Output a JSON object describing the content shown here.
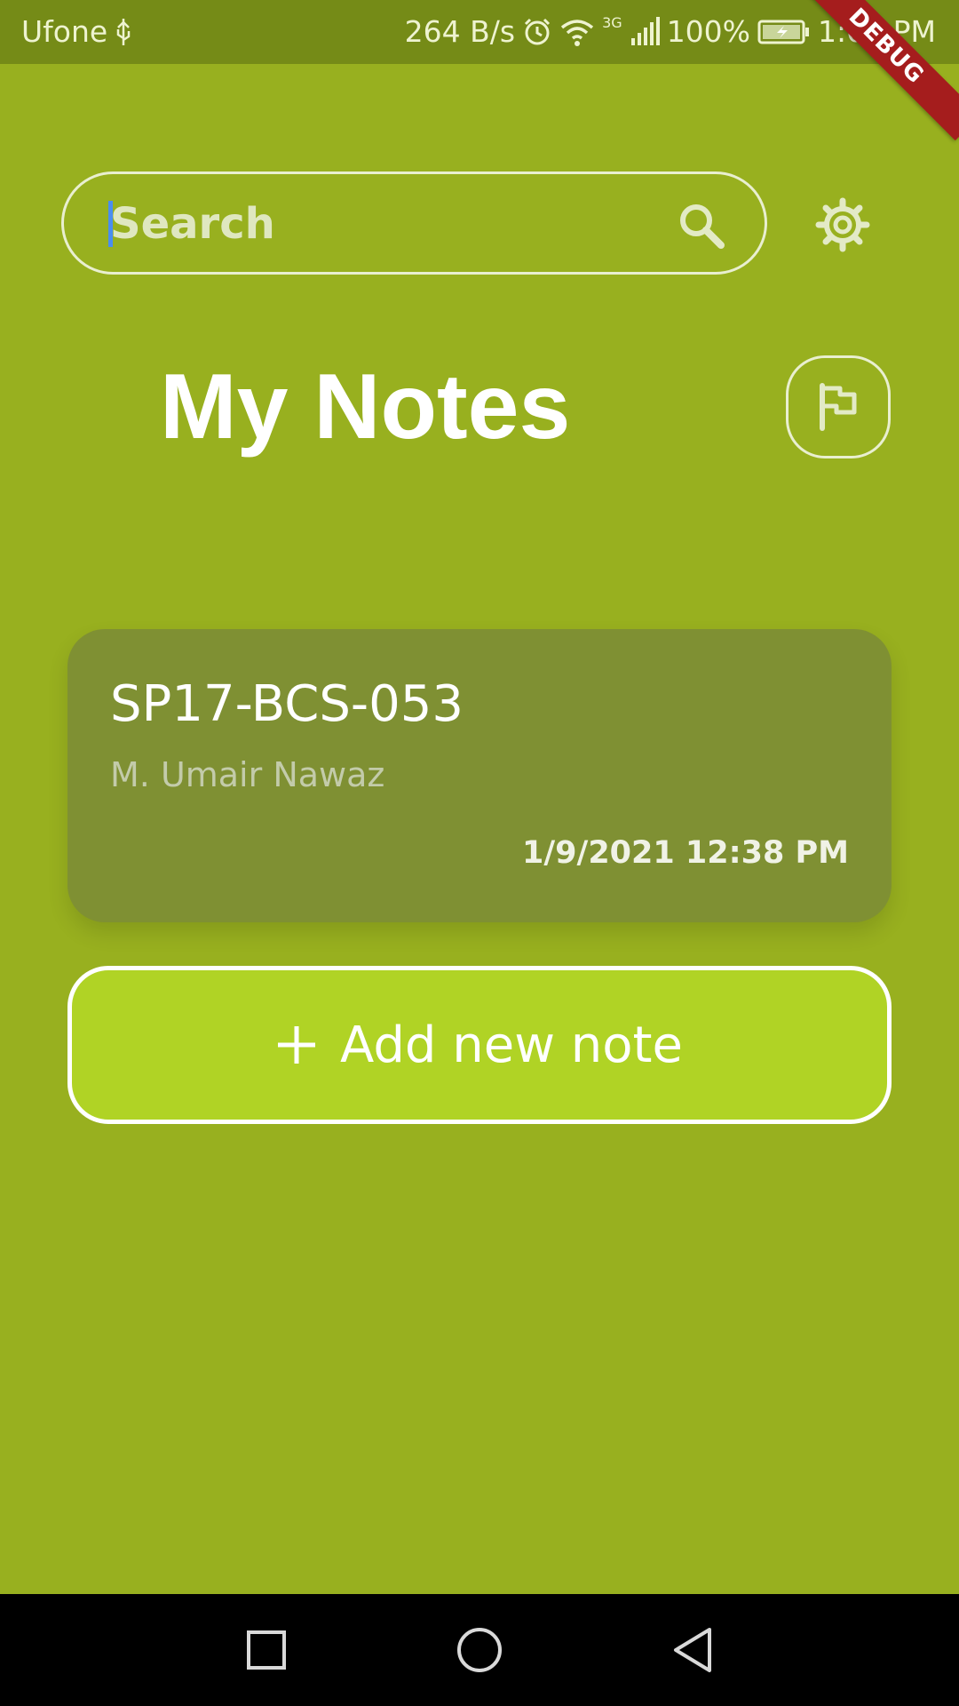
{
  "status_bar": {
    "carrier": "Ufone",
    "speed": "264 B/s",
    "network": "3G",
    "battery": "100%",
    "time": "1:05 PM",
    "icons": [
      "usb-icon",
      "alarm-icon",
      "wifi-icon",
      "signal-icon",
      "battery-charging-icon"
    ]
  },
  "debug_banner": "DEBUG",
  "search": {
    "placeholder": "Search",
    "value": "",
    "icon": "search-icon"
  },
  "header": {
    "settings_icon": "gear-icon",
    "title": "My Notes",
    "flag_icon": "flag-icon"
  },
  "notes": [
    {
      "title": "SP17-BCS-053",
      "subtitle": "M. Umair Nawaz",
      "date": "1/9/2021 12:38 PM"
    }
  ],
  "add_button": {
    "icon": "plus-icon",
    "label": "Add new note"
  },
  "nav_bar": {
    "items": [
      "recent-apps-icon",
      "home-icon",
      "back-icon"
    ]
  },
  "colors": {
    "background": "#98b01f",
    "status_bar": "#758b17",
    "note_card": "#7f9033",
    "add_button": "#b0d325",
    "debug_ribbon": "#a51d1d",
    "cursor": "#4a8df0"
  }
}
